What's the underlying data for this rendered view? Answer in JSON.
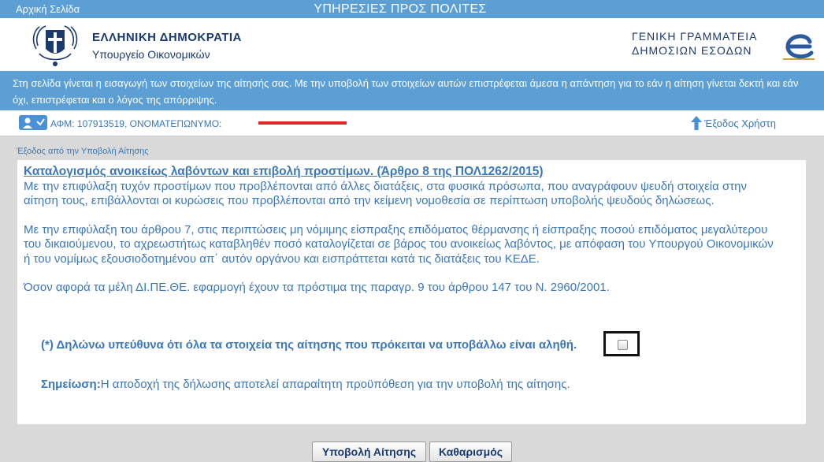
{
  "topbar": {
    "home_link": "Αρχική Σελίδα",
    "title": "ΥΠΗΡΕΣΙΕΣ ΠΡΟΣ ΠΟΛΙΤΕΣ"
  },
  "header": {
    "gov_name": "ΕΛΛΗΝΙΚΗ ΔΗΜΟΚΡΑΤΙΑ",
    "ministry": "Υπουργείο Οικονομικών",
    "agency_line1": "ΓΕΝΙΚΗ ΓΡΑΜΜΑΤΕΙΑ",
    "agency_line2": "ΔΗΜΟΣΙΩΝ ΕΣΟΔΩΝ"
  },
  "info_text": "Στη σελίδα γίνεται η εισαγωγή των στοιχείων της αίτησής σας. Με την υποβολή των στοιχείων αυτών επιστρέφεται άμεσα η απάντηση για το εάν η αίτηση γίνεται δεκτή και εάν όχι, επιστρέφεται και ο λόγος της απόρριψης.",
  "user": {
    "afm_label": "ΑΦΜ: 107913519, ΟΝΟΜΑΤΕΠΩΝΥΜΟ:",
    "exit_label": "Έξοδος Χρήστη"
  },
  "exit_submission": "Έξοδος από την Υποβολή Αίτησης",
  "content": {
    "heading": "Καταλογισμός ανοικείως λαβόντων και επιβολή προστίμων. (Άρθρο 8 της ΠΟΛ1262/2015)",
    "para1": "Με την επιφύλαξη τυχόν προστίμων που προβλέπονται από άλλες διατάξεις, στα φυσικά πρόσωπα, που αναγράφουν ψευδή στοιχεία στην αίτηση τους, επιβάλλονται οι κυρώσεις που προβλέπονται από την κείμενη νομοθεσία σε περίπτωση υποβολής ψευδούς δηλώσεως.",
    "para2": "Με την επιφύλαξη του άρθρου 7, στις περιπτώσεις μη νόμιμης είσπραξης επιδόματος θέρμανσης ή είσπραξης ποσού επιδόματος μεγαλύτερου του δικαιούμενου, το αχρεωστήτως καταβληθέν ποσό καταλογίζεται σε βάρος του ανοικείως λαβόντος, με απόφαση του Υπουργού Οικονομικών ή του νομίμως εξουσιοδοτημένου απ΄ αυτόν οργάνου και εισπράττεται κατά τις διατάξεις του ΚΕΔΕ.",
    "para3": "Όσον αφορά τα μέλη ΔΙ.ΠΕ.ΘΕ. εφαρμογή έχουν τα πρόστιμα της παραγρ. 9 του άρθρου 147 του Ν. 2960/2001.",
    "declaration": "(*) Δηλώνω υπεύθυνα ότι όλα τα στοιχεία της αίτησης που πρόκειται να υποβάλλω είναι αληθή.",
    "note_label": "Σημείωση:",
    "note_text": "Η αποδοχή της δήλωσης αποτελεί απαραίτητη προϋπόθεση για την υποβολή της αίτησης."
  },
  "buttons": {
    "submit": "Υποβολή Αίτησης",
    "clear": "Καθαρισμός"
  },
  "colors": {
    "accent_blue": "#5b9fd4",
    "text_blue": "#3b78b5",
    "dark_blue": "#1a3a6e",
    "redaction": "#e0262b"
  }
}
